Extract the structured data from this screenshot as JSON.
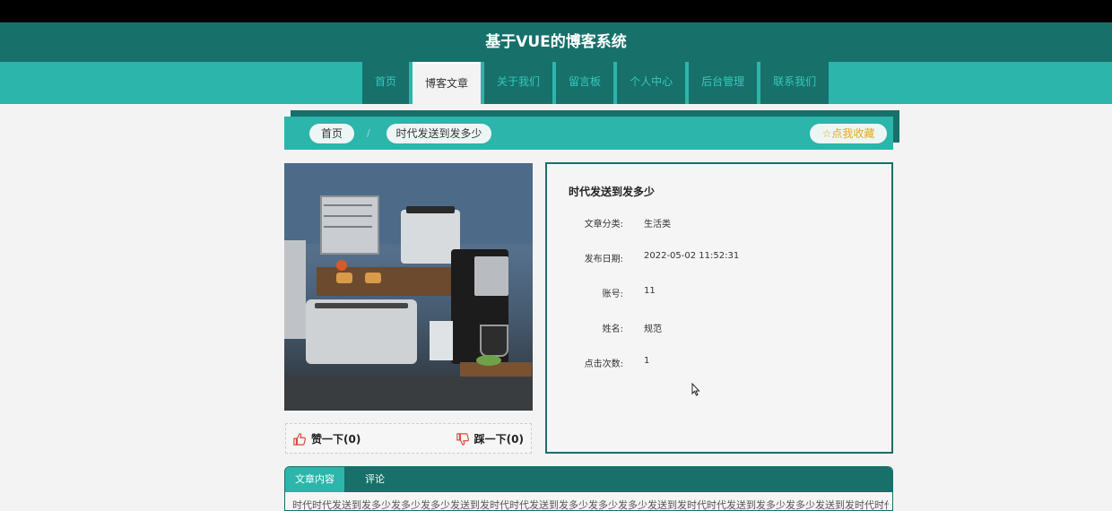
{
  "header": {
    "title": "基于VUE的博客系统"
  },
  "nav": {
    "items": [
      {
        "label": "首页"
      },
      {
        "label": "博客文章"
      },
      {
        "label": "关于我们"
      },
      {
        "label": "留言板"
      },
      {
        "label": "个人中心"
      },
      {
        "label": "后台管理"
      },
      {
        "label": "联系我们"
      }
    ],
    "active_index": 1
  },
  "breadcrumb": {
    "home": "首页",
    "separator": "/",
    "current": "时代发送到发多少",
    "favorite": "☆点我收藏"
  },
  "article": {
    "title": "时代发送到发多少",
    "fields": [
      {
        "label": "文章分类:",
        "value": "生活类"
      },
      {
        "label": "发布日期:",
        "value": "2022-05-02 11:52:31"
      },
      {
        "label": "账号:",
        "value": "11"
      },
      {
        "label": "姓名:",
        "value": "规范"
      },
      {
        "label": "点击次数:",
        "value": "1"
      }
    ]
  },
  "votes": {
    "like": "赞一下(0)",
    "dislike": "踩一下(0)"
  },
  "tabs": {
    "content": "文章内容",
    "comments": "评论"
  },
  "content": {
    "preview": "时代时代发送到发多少发多少发多少发送到发时代时代发送到发多少发多少发多少发送到发时代时代发送到发多少发多少发送到发时代时代发送到发"
  },
  "colors": {
    "dark_teal": "#17706a",
    "teal": "#2cb5ab",
    "favorite": "#e6a817",
    "thumb_icon": "#d9463a"
  },
  "icons": {
    "like": "thumbs-up-icon",
    "dislike": "thumbs-down-icon",
    "favorite": "star-icon",
    "cursor": "mouse-pointer-icon"
  }
}
